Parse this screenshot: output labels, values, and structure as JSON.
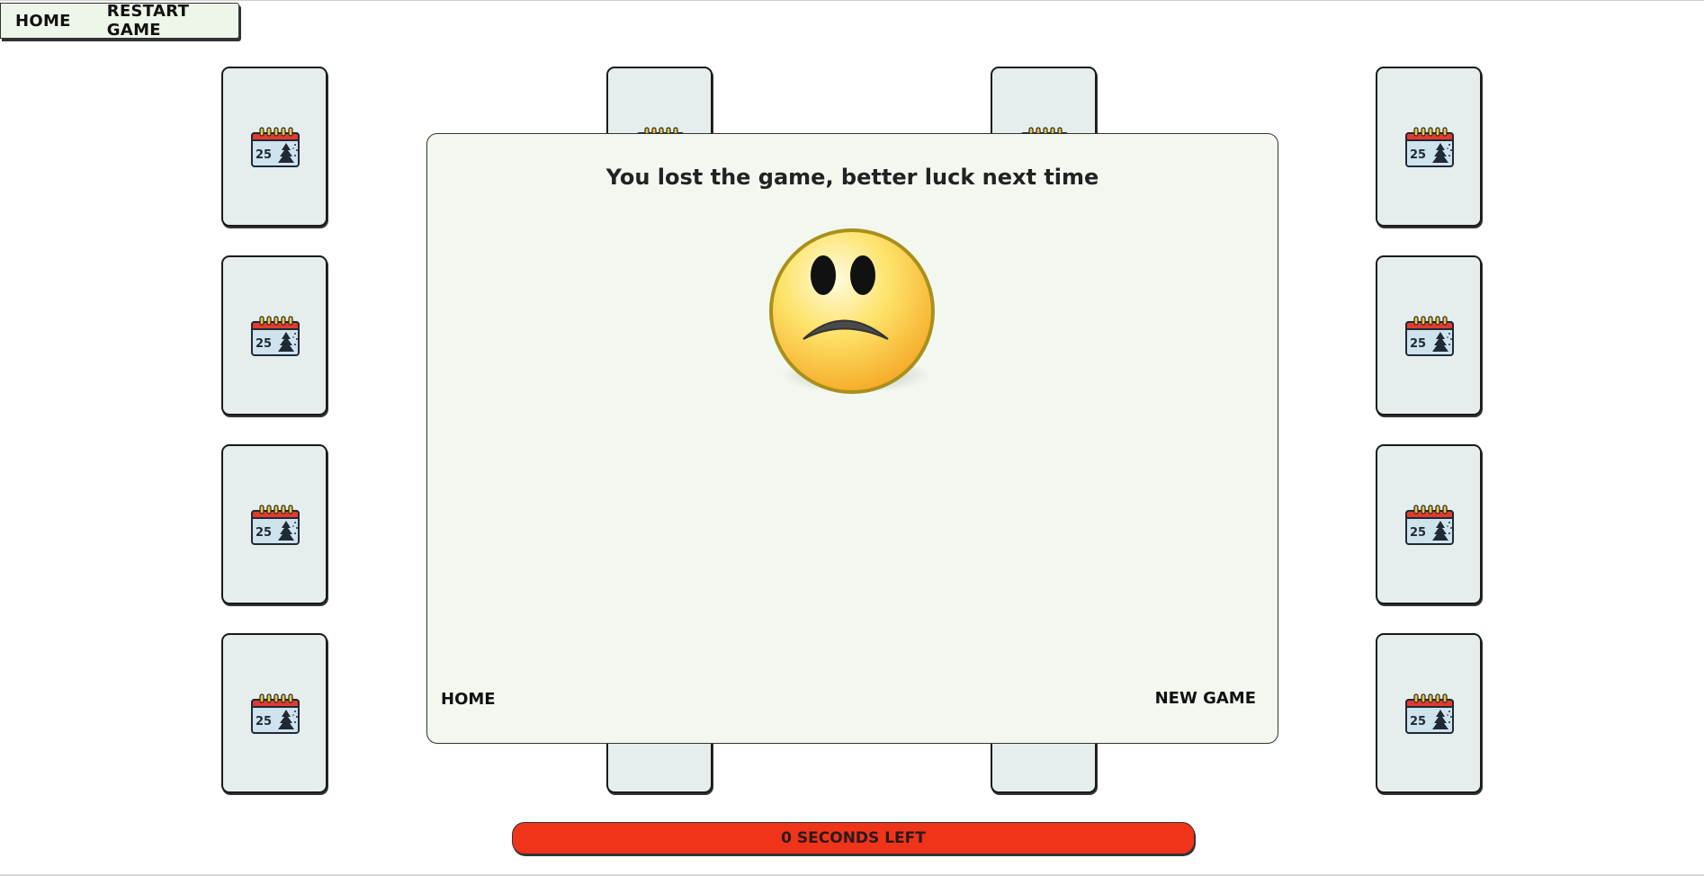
{
  "toolbar": {
    "home_label": "HOME",
    "restart_label": "RESTART GAME"
  },
  "cards": {
    "icon": "christmas-calendar-icon",
    "calendar_number": "25",
    "count": 16
  },
  "modal": {
    "title": "You lost the game, better luck next time",
    "face_icon": "sad-face-icon",
    "home_label": "HOME",
    "new_game_label": "NEW GAME"
  },
  "timer": {
    "text": "0 SECONDS LEFT",
    "color": "#f0341a"
  },
  "colors": {
    "card_bg": "#e5eeed",
    "panel_bg": "#f2f8ef",
    "toolbar_bg": "#edf6e8"
  }
}
